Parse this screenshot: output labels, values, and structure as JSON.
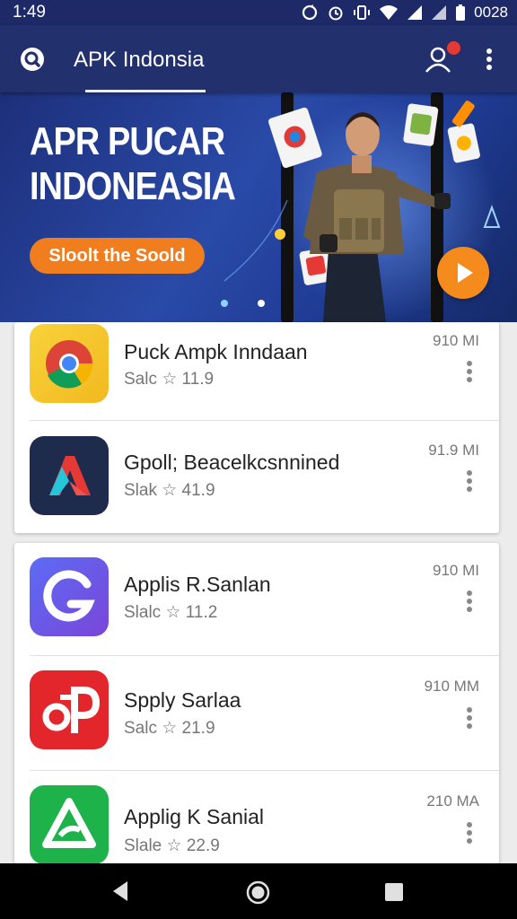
{
  "status_bar": {
    "time": "1:49",
    "battery_text": "0028"
  },
  "app_bar": {
    "title": "APK Indonsia"
  },
  "banner": {
    "headline_line1": "APR PUCAR",
    "headline_line2": "INDONEASIA",
    "cta_label": "Sloolt the Soold"
  },
  "apps": [
    {
      "name": "Puck Ampk Inndaan",
      "meta": "Salc ☆ 11.9",
      "size": "910 MI"
    },
    {
      "name": "Gpoll; Beacelkcsnnined",
      "meta": "Slak ☆ 41.9",
      "size": "91.9 MI"
    },
    {
      "name": "Applis R.Sanlan",
      "meta": "Slalc ☆ 11.2",
      "size": "910 MI"
    },
    {
      "name": "Spply Sarlaa",
      "meta": "Salc ☆ 21.9",
      "size": "910 MM"
    },
    {
      "name": "Applig K Sanial",
      "meta": "Slale ☆ 22.9",
      "size": "210 MA"
    }
  ],
  "colors": {
    "app_bar": "#23306e",
    "status_bar": "#1e2a68",
    "cta": "#f07d1e",
    "play": "#f58a1d"
  }
}
